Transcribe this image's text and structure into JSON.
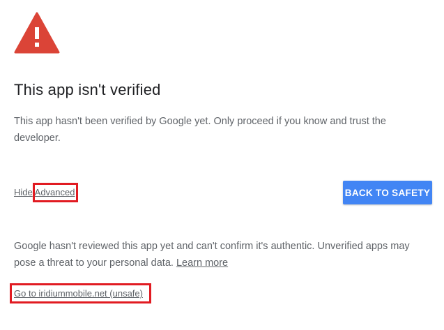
{
  "warning": {
    "icon": "warning-triangle-icon",
    "color": "#db4437"
  },
  "title": "This app isn't verified",
  "description": "This app hasn't been verified by Google yet. Only proceed if you know and trust the developer.",
  "advanced": {
    "hide_label": "Hide",
    "advanced_label": "Advanced"
  },
  "back_to_safety": {
    "label": "BACK TO SAFETY",
    "color": "#4285f4"
  },
  "details": {
    "text": "Google hasn't reviewed this app yet and can't confirm it's authentic. Unverified apps may pose a threat to your personal data.",
    "learn_more": "Learn more"
  },
  "unsafe_link": "Go to iridiummobile.net (unsafe)",
  "highlight_color": "#e11b22"
}
